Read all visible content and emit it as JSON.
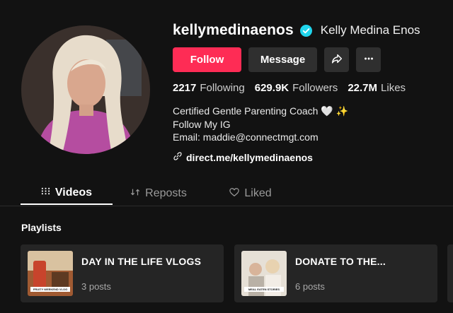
{
  "profile": {
    "username": "kellymedinaenos",
    "display_name": "Kelly Medina Enos",
    "verified": true
  },
  "actions": {
    "follow_label": "Follow",
    "message_label": "Message",
    "share_icon": "share-icon",
    "more_icon": "more-icon"
  },
  "stats": {
    "following_count": "2217",
    "following_label": "Following",
    "followers_count": "629.9K",
    "followers_label": "Followers",
    "likes_count": "22.7M",
    "likes_label": "Likes"
  },
  "bio": {
    "line1": "Certified Gentle Parenting Coach 🤍 ✨",
    "line2": "Follow My IG",
    "line3": "Email: maddie@connectmgt.com"
  },
  "link": {
    "icon": "link-icon",
    "text": "direct.me/kellymedinaenos"
  },
  "tabs": [
    {
      "label": "Videos",
      "icon": "grid-icon",
      "active": true
    },
    {
      "label": "Reposts",
      "icon": "repost-icon",
      "active": false
    },
    {
      "label": "Liked",
      "icon": "heart-icon",
      "active": false
    }
  ],
  "playlists": {
    "title": "Playlists",
    "items": [
      {
        "name": "DAY IN THE LIFE VLOGS",
        "count": "3 posts",
        "thumb_caption": "FRUITY WEEKEND VLOG"
      },
      {
        "name": "DONATE TO THE...",
        "count": "6 posts",
        "thumb_caption": "MEAL EATEN STORIES"
      }
    ]
  },
  "colors": {
    "accent": "#fe2c55",
    "background": "#121212",
    "card": "#252525",
    "verified": "#20d5ec"
  }
}
